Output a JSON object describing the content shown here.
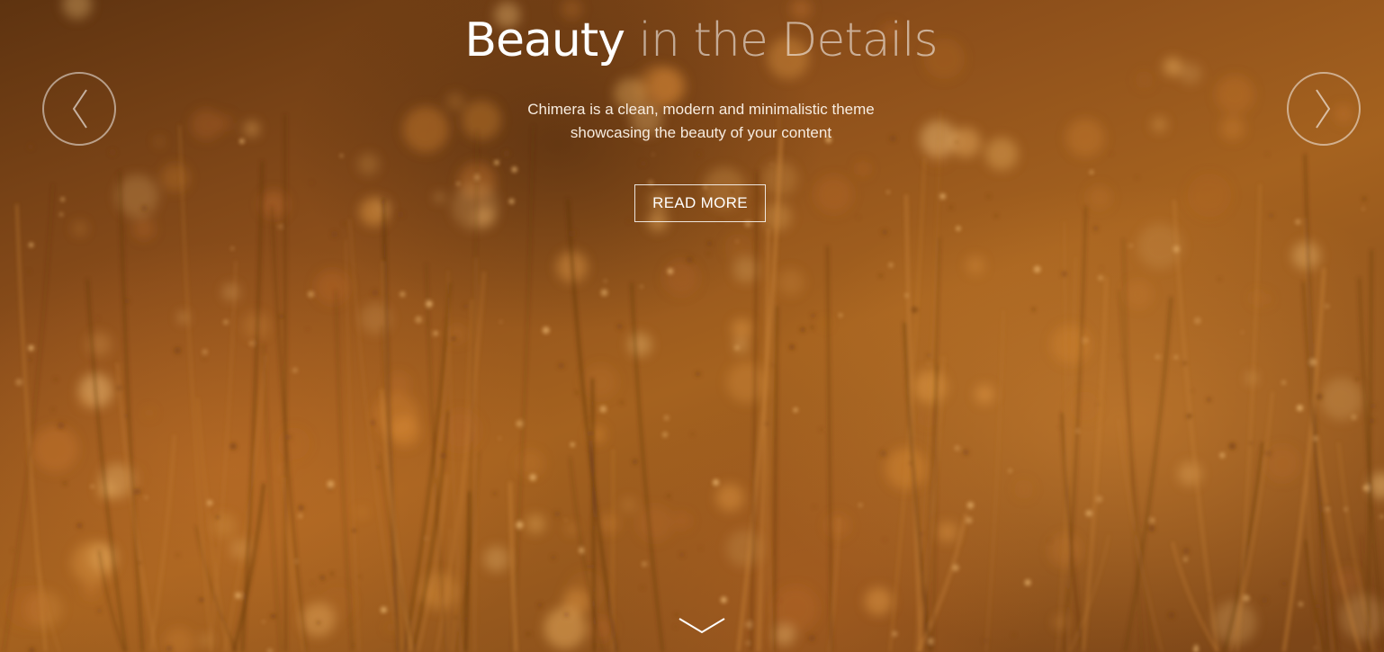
{
  "hero": {
    "title_main": "Beauty",
    "title_light": "in the Details",
    "subtitle_line1": "Chimera is a clean, modern and minimalistic theme",
    "subtitle_line2": "showcasing the beauty of your content",
    "button_label": "READ MORE"
  },
  "icons": {
    "prev": "chevron-left-icon",
    "next": "chevron-right-icon",
    "scroll": "chevron-down-icon"
  },
  "colors": {
    "background": "#8a4d1a",
    "text": "#ffffff"
  }
}
